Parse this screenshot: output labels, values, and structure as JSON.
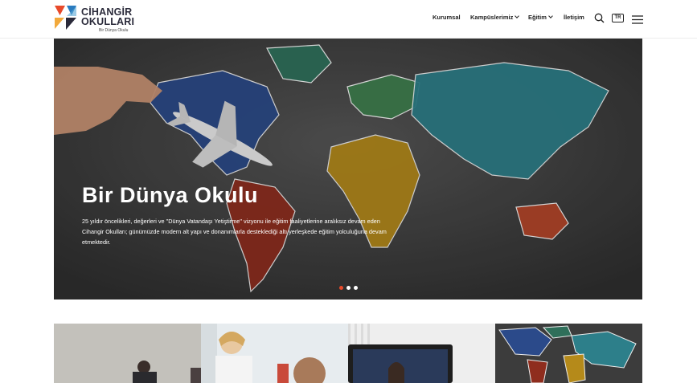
{
  "brand": {
    "name_line1": "CİHANGİR",
    "name_line2": "OKULLARI",
    "tagline": "Bir Dünya Okulu",
    "colors": [
      "#e84a2a",
      "#2a7bbf",
      "#f2a93b",
      "#2a2a3a"
    ]
  },
  "nav": {
    "items": [
      {
        "label": "Kurumsal",
        "has_dropdown": false
      },
      {
        "label": "Kampüslerimiz",
        "has_dropdown": true
      },
      {
        "label": "Eğitim",
        "has_dropdown": true
      },
      {
        "label": "İletişim",
        "has_dropdown": false
      }
    ],
    "language": "TR",
    "icons": [
      "search-icon",
      "language-badge",
      "menu-icon"
    ]
  },
  "hero": {
    "title": "Bir Dünya Okulu",
    "description": "25 yıldır öncelikleri, değerleri ve \"Dünya Vatandaşı Yetiştirme\" vizyonu ile eğitim faaliyetlerine aralıksız devam eden Cihangir Okulları; günümüzde modern alt yapı ve donanımlarla desteklediği altı yerleşkede eğitim yolculuğuna devam etmektedir.",
    "slider": {
      "count": 3,
      "active": 0,
      "active_color": "#e84a2a",
      "inactive_color": "#ffffff"
    }
  },
  "gallery": {
    "cards": [
      {
        "name": "gallery-card-classroom"
      },
      {
        "name": "gallery-card-students"
      },
      {
        "name": "gallery-card-video-call"
      },
      {
        "name": "gallery-card-world-map"
      }
    ]
  }
}
